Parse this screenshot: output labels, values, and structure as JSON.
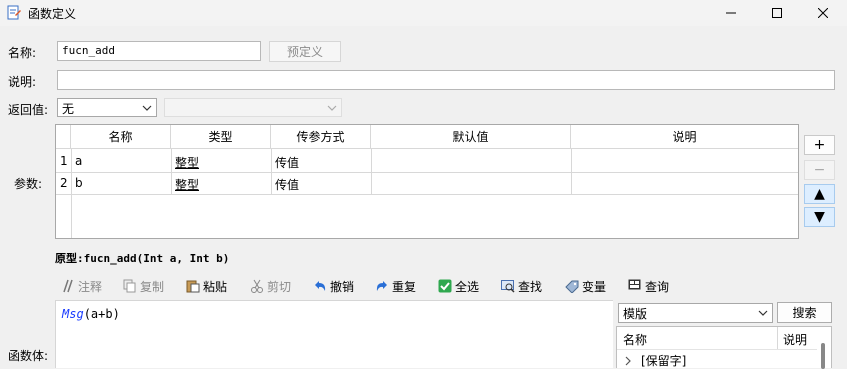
{
  "window": {
    "title": "函数定义"
  },
  "form": {
    "name_label": "名称:",
    "name_value": "fucn_add",
    "predefine_button": "预定义",
    "desc_label": "说明:",
    "desc_value": "",
    "return_label": "返回值:",
    "return_value": "无",
    "params_label": "参数:",
    "body_label": "函数体:"
  },
  "params_table": {
    "columns": [
      "名称",
      "类型",
      "传参方式",
      "默认值",
      "说明"
    ],
    "rows": [
      {
        "num": "1",
        "name": "a",
        "type": "整型",
        "mode": "传值",
        "default": "",
        "desc": ""
      },
      {
        "num": "2",
        "name": "b",
        "type": "整型",
        "mode": "传值",
        "default": "",
        "desc": ""
      }
    ]
  },
  "side_buttons": {
    "add": "+",
    "remove": "−",
    "up": "▲",
    "down": "▼"
  },
  "prototype": {
    "label": "原型:",
    "text": "fucn_add(Int a, Int b)"
  },
  "toolbar": {
    "comment": "注释",
    "copy": "复制",
    "paste": "粘贴",
    "cut": "剪切",
    "undo": "撤销",
    "redo": "重复",
    "select_all": "全选",
    "find": "查找",
    "variable": "变量",
    "query": "查询"
  },
  "editor": {
    "code_keyword": "Msg",
    "code_rest": "(a+b)"
  },
  "right_panel": {
    "template_select": "模版",
    "search_button": "搜索",
    "col_name": "名称",
    "col_desc": "说明",
    "tree_item": "[保留字]"
  },
  "colors": {
    "accent_blue": "#1a3cff",
    "selection_blue": "#ddeeff",
    "check_green": "#2fa84f"
  }
}
